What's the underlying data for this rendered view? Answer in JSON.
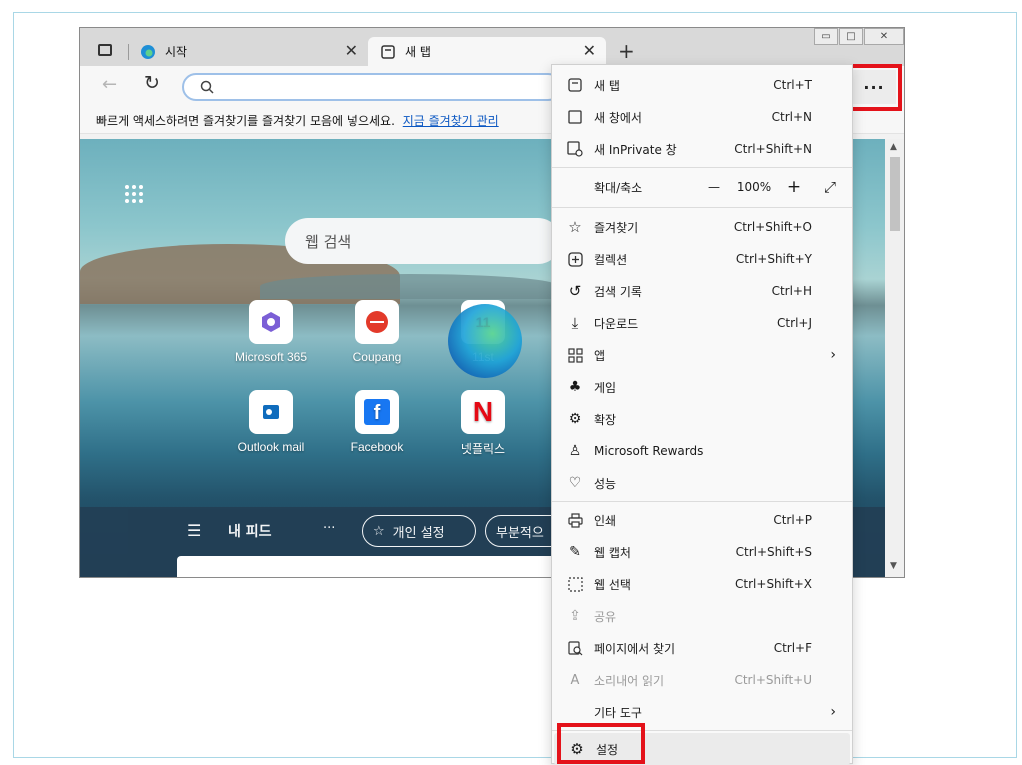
{
  "tabs": [
    {
      "title": "시작",
      "icon": "edge-icon"
    },
    {
      "title": "새 탭",
      "icon": "new-tab-icon"
    }
  ],
  "window_controls": {
    "minimize": "▭",
    "maximize": "□",
    "close": "✕"
  },
  "toolbar": {
    "new_tab_symbol": "+",
    "more_symbol": "···"
  },
  "favbar": {
    "text": "빠르게 액세스하려면 즐겨찾기를 즐겨찾기 모음에 넣으세요.",
    "link": "지금 즐겨찾기 관리"
  },
  "page": {
    "search_placeholder": "웹 검색",
    "tiles": [
      {
        "label": "Microsoft 365"
      },
      {
        "label": "Coupang"
      },
      {
        "label": "11st",
        "icon_text": "11"
      },
      {
        "label": "Outlook mail"
      },
      {
        "label": "Facebook",
        "icon_text": "f"
      },
      {
        "label": "넷플릭스",
        "icon_text": "N"
      }
    ],
    "feed_label": "내 피드",
    "personalize": "개인 설정",
    "partial_pill": "부분적으",
    "more_dots": "···"
  },
  "menu": {
    "items": [
      {
        "label": "새 탭",
        "shortcut": "Ctrl+T",
        "icon": "new-tab-icon"
      },
      {
        "label": "새 창에서",
        "shortcut": "Ctrl+N",
        "icon": "new-window-icon"
      },
      {
        "label": "새 InPrivate 창",
        "shortcut": "Ctrl+Shift+N",
        "icon": "inprivate-icon"
      },
      {
        "label": "확대/축소",
        "zoom": "100%",
        "icon": ""
      },
      {
        "label": "즐겨찾기",
        "shortcut": "Ctrl+Shift+O",
        "icon": "favorites-icon"
      },
      {
        "label": "컬렉션",
        "shortcut": "Ctrl+Shift+Y",
        "icon": "collections-icon"
      },
      {
        "label": "검색 기록",
        "shortcut": "Ctrl+H",
        "icon": "history-icon"
      },
      {
        "label": "다운로드",
        "shortcut": "Ctrl+J",
        "icon": "download-icon"
      },
      {
        "label": "앱",
        "shortcut": "",
        "icon": "apps-icon"
      },
      {
        "label": "게임",
        "shortcut": "",
        "icon": "games-icon"
      },
      {
        "label": "확장",
        "shortcut": "",
        "icon": "extensions-icon"
      },
      {
        "label": "Microsoft Rewards",
        "shortcut": "",
        "icon": "rewards-icon"
      },
      {
        "label": "성능",
        "shortcut": "",
        "icon": "performance-icon"
      },
      {
        "label": "인쇄",
        "shortcut": "Ctrl+P",
        "icon": "print-icon"
      },
      {
        "label": "웹 캡처",
        "shortcut": "Ctrl+Shift+S",
        "icon": "web-capture-icon"
      },
      {
        "label": "웹 선택",
        "shortcut": "Ctrl+Shift+X",
        "icon": "web-select-icon"
      },
      {
        "label": "공유",
        "shortcut": "",
        "icon": "share-icon"
      },
      {
        "label": "페이지에서 찾기",
        "shortcut": "Ctrl+F",
        "icon": "find-icon"
      },
      {
        "label": "소리내어 읽기",
        "shortcut": "Ctrl+Shift+U",
        "icon": "read-aloud-icon"
      },
      {
        "label": "기타 도구",
        "shortcut": "",
        "icon": ""
      },
      {
        "label": "설정",
        "shortcut": "",
        "icon": "settings-icon"
      }
    ],
    "zoom_minus": "—",
    "zoom_plus": "+",
    "submenu_arrow": "›"
  },
  "colors": {
    "highlight": "#e4121a",
    "link": "#0b57c2"
  }
}
